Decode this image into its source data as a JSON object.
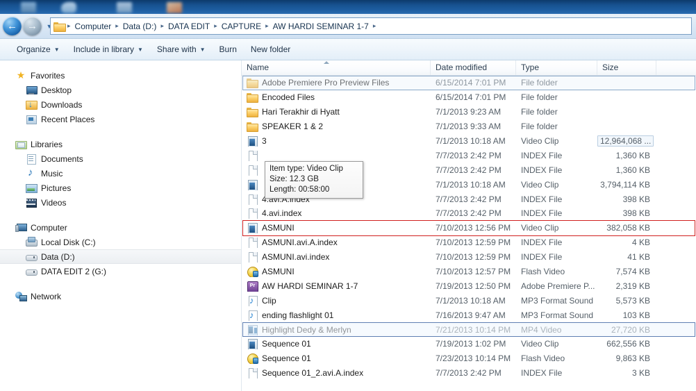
{
  "window": {
    "title": "AW HARDI SEMINAR 1-7"
  },
  "address_bar": {
    "back_icon": "back-arrow-icon",
    "forward_icon": "forward-arrow-icon",
    "history_icon": "history-dropdown-icon",
    "folder_icon": "folder-icon",
    "breadcrumbs": [
      "Computer",
      "Data (D:)",
      "DATA EDIT",
      "CAPTURE",
      "AW HARDI SEMINAR 1-7"
    ],
    "separator": "▸"
  },
  "toolbar": {
    "items": [
      {
        "label": "Organize",
        "has_caret": true
      },
      {
        "label": "Include in library",
        "has_caret": true
      },
      {
        "label": "Share with",
        "has_caret": true
      },
      {
        "label": "Burn",
        "has_caret": false
      },
      {
        "label": "New folder",
        "has_caret": false
      }
    ]
  },
  "sidebar": {
    "groups": [
      {
        "header": {
          "label": "Favorites",
          "icon": "star-icon"
        },
        "items": [
          {
            "label": "Desktop",
            "icon": "desktop-icon"
          },
          {
            "label": "Downloads",
            "icon": "downloads-icon"
          },
          {
            "label": "Recent Places",
            "icon": "recent-places-icon"
          }
        ]
      },
      {
        "header": {
          "label": "Libraries",
          "icon": "libraries-icon"
        },
        "items": [
          {
            "label": "Documents",
            "icon": "documents-icon"
          },
          {
            "label": "Music",
            "icon": "music-icon"
          },
          {
            "label": "Pictures",
            "icon": "pictures-icon"
          },
          {
            "label": "Videos",
            "icon": "videos-icon"
          }
        ]
      },
      {
        "header": {
          "label": "Computer",
          "icon": "computer-icon"
        },
        "items": [
          {
            "label": "Local Disk (C:)",
            "icon": "local-disk-icon",
            "selected": false
          },
          {
            "label": "Data (D:)",
            "icon": "drive-icon",
            "selected": true
          },
          {
            "label": "DATA EDIT 2 (G:)",
            "icon": "drive-icon",
            "selected": false
          }
        ]
      },
      {
        "header": {
          "label": "Network",
          "icon": "network-icon"
        },
        "items": []
      }
    ]
  },
  "file_list": {
    "columns": [
      {
        "key": "name",
        "label": "Name",
        "sorted": "asc"
      },
      {
        "key": "date",
        "label": "Date modified"
      },
      {
        "key": "type",
        "label": "Type"
      },
      {
        "key": "size",
        "label": "Size"
      }
    ],
    "rows": [
      {
        "name": "Adobe Premiere Pro Preview Files",
        "date": "6/15/2014 7:01 PM",
        "type": "File folder",
        "size": "",
        "icon": "folder-icon",
        "state": "focus"
      },
      {
        "name": "Encoded Files",
        "date": "6/15/2014 7:01 PM",
        "type": "File folder",
        "size": "",
        "icon": "folder-icon",
        "state": ""
      },
      {
        "name": "Hari Terakhir di Hyatt",
        "date": "7/1/2013 9:23 AM",
        "type": "File folder",
        "size": "",
        "icon": "folder-icon",
        "state": ""
      },
      {
        "name": "SPEAKER 1 & 2",
        "date": "7/1/2013 9:33 AM",
        "type": "File folder",
        "size": "",
        "icon": "folder-icon",
        "state": ""
      },
      {
        "name": "3",
        "date": "7/1/2013 10:18 AM",
        "type": "Video Clip",
        "size": "12,964,068 ...",
        "icon": "video-clip-icon",
        "state": "size-boxed"
      },
      {
        "name": "",
        "date": "7/7/2013 2:42 PM",
        "type": "INDEX File",
        "size": "1,360 KB",
        "icon": "index-file-icon",
        "state": "covered"
      },
      {
        "name": "",
        "date": "7/7/2013 2:42 PM",
        "type": "INDEX File",
        "size": "1,360 KB",
        "icon": "index-file-icon",
        "state": "covered"
      },
      {
        "name": "",
        "date": "7/1/2013 10:18 AM",
        "type": "Video Clip",
        "size": "3,794,114 KB",
        "icon": "video-clip-icon",
        "state": "covered"
      },
      {
        "name": "4.avi.A.index",
        "date": "7/7/2013 2:42 PM",
        "type": "INDEX File",
        "size": "398 KB",
        "icon": "index-file-icon",
        "state": ""
      },
      {
        "name": "4.avi.index",
        "date": "7/7/2013 2:42 PM",
        "type": "INDEX File",
        "size": "398 KB",
        "icon": "index-file-icon",
        "state": ""
      },
      {
        "name": "ASMUNI",
        "date": "7/10/2013 12:56 PM",
        "type": "Video Clip",
        "size": "382,058 KB",
        "icon": "video-clip-icon",
        "state": "annot-red"
      },
      {
        "name": "ASMUNI.avi.A.index",
        "date": "7/10/2013 12:59 PM",
        "type": "INDEX File",
        "size": "4 KB",
        "icon": "index-file-icon",
        "state": ""
      },
      {
        "name": "ASMUNI.avi.index",
        "date": "7/10/2013 12:59 PM",
        "type": "INDEX File",
        "size": "41 KB",
        "icon": "index-file-icon",
        "state": ""
      },
      {
        "name": "ASMUNI",
        "date": "7/10/2013 12:57 PM",
        "type": "Flash Video",
        "size": "7,574 KB",
        "icon": "flash-video-icon",
        "state": ""
      },
      {
        "name": "AW HARDI SEMINAR 1-7",
        "date": "7/19/2013 12:50 PM",
        "type": "Adobe Premiere P...",
        "size": "2,319 KB",
        "icon": "premiere-project-icon",
        "state": ""
      },
      {
        "name": "Clip",
        "date": "7/1/2013 10:18 AM",
        "type": "MP3 Format Sound",
        "size": "5,573 KB",
        "icon": "mp3-audio-icon",
        "state": ""
      },
      {
        "name": "ending flashlight 01",
        "date": "7/16/2013 9:47 AM",
        "type": "MP3 Format Sound",
        "size": "103 KB",
        "icon": "mp3-audio-icon",
        "state": ""
      },
      {
        "name": "Highlight Dedy & Merlyn",
        "date": "7/21/2013 10:14 PM",
        "type": "MP4 Video",
        "size": "27,720 KB",
        "icon": "mp4-video-icon",
        "state": "selected"
      },
      {
        "name": "Sequence 01",
        "date": "7/19/2013 1:02 PM",
        "type": "Video Clip",
        "size": "662,556 KB",
        "icon": "video-clip-icon",
        "state": ""
      },
      {
        "name": "Sequence 01",
        "date": "7/23/2013 10:14 PM",
        "type": "Flash Video",
        "size": "9,863 KB",
        "icon": "flash-video-icon",
        "state": ""
      },
      {
        "name": "Sequence 01_2.avi.A.index",
        "date": "7/7/2013 2:42 PM",
        "type": "INDEX File",
        "size": "3 KB",
        "icon": "index-file-icon",
        "state": ""
      }
    ]
  },
  "tooltip": {
    "lines": [
      "Item type: Video Clip",
      "Size: 12.3 GB",
      "Length: 00:58:00"
    ]
  },
  "colors": {
    "annotation_red": "#d0201f",
    "selection_blue": "#5f7fb2",
    "folder_yellow": "#edb13f"
  }
}
